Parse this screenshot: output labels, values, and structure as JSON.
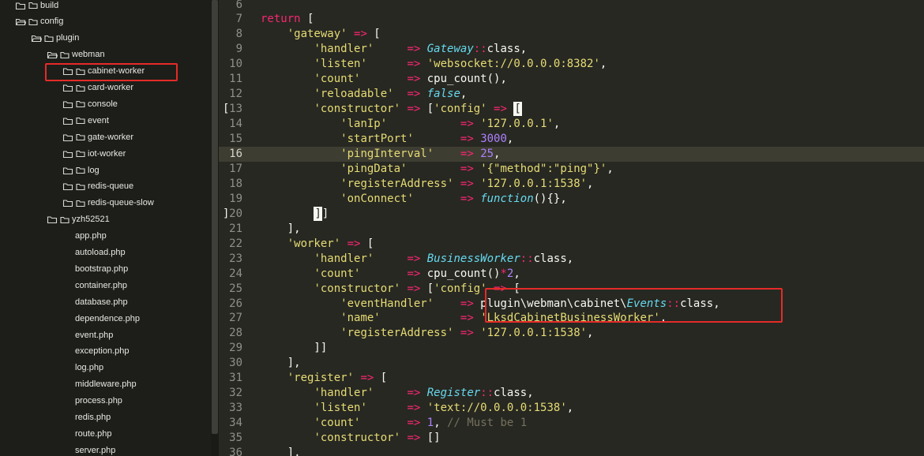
{
  "sidebar": {
    "items": [
      {
        "label": "build",
        "type": "folder",
        "open": false,
        "depth": 0
      },
      {
        "label": "config",
        "type": "folder",
        "open": true,
        "depth": 0
      },
      {
        "label": "plugin",
        "type": "folder",
        "open": true,
        "depth": 1
      },
      {
        "label": "webman",
        "type": "folder",
        "open": true,
        "depth": 2
      },
      {
        "label": "cabinet-worker",
        "type": "folder",
        "open": false,
        "depth": 3,
        "highlighted": true
      },
      {
        "label": "card-worker",
        "type": "folder",
        "open": false,
        "depth": 3
      },
      {
        "label": "console",
        "type": "folder",
        "open": false,
        "depth": 3
      },
      {
        "label": "event",
        "type": "folder",
        "open": false,
        "depth": 3
      },
      {
        "label": "gate-worker",
        "type": "folder",
        "open": false,
        "depth": 3
      },
      {
        "label": "iot-worker",
        "type": "folder",
        "open": false,
        "depth": 3
      },
      {
        "label": "log",
        "type": "folder",
        "open": false,
        "depth": 3
      },
      {
        "label": "redis-queue",
        "type": "folder",
        "open": false,
        "depth": 3
      },
      {
        "label": "redis-queue-slow",
        "type": "folder",
        "open": false,
        "depth": 3
      },
      {
        "label": "yzh52521",
        "type": "folder",
        "open": false,
        "depth": 2
      },
      {
        "label": "app.php",
        "type": "file",
        "depth": 2
      },
      {
        "label": "autoload.php",
        "type": "file",
        "depth": 2
      },
      {
        "label": "bootstrap.php",
        "type": "file",
        "depth": 2
      },
      {
        "label": "container.php",
        "type": "file",
        "depth": 2
      },
      {
        "label": "database.php",
        "type": "file",
        "depth": 2
      },
      {
        "label": "dependence.php",
        "type": "file",
        "depth": 2
      },
      {
        "label": "event.php",
        "type": "file",
        "depth": 2
      },
      {
        "label": "exception.php",
        "type": "file",
        "depth": 2
      },
      {
        "label": "log.php",
        "type": "file",
        "depth": 2
      },
      {
        "label": "middleware.php",
        "type": "file",
        "depth": 2
      },
      {
        "label": "process.php",
        "type": "file",
        "depth": 2
      },
      {
        "label": "redis.php",
        "type": "file",
        "depth": 2
      },
      {
        "label": "route.php",
        "type": "file",
        "depth": 2
      },
      {
        "label": "server.php",
        "type": "file",
        "depth": 2
      }
    ]
  },
  "editor": {
    "active_line": 16,
    "lines": [
      {
        "n": "6",
        "fold": "",
        "tokens": []
      },
      {
        "n": "7",
        "fold": "",
        "tokens": [
          [
            "kw",
            "return"
          ],
          [
            "pl",
            " ["
          ]
        ]
      },
      {
        "n": "8",
        "fold": "",
        "tokens": [
          [
            "pl",
            "    "
          ],
          [
            "str",
            "'gateway'"
          ],
          [
            "pl",
            " "
          ],
          [
            "op",
            "=>"
          ],
          [
            "pl",
            " ["
          ]
        ]
      },
      {
        "n": "9",
        "fold": "",
        "tokens": [
          [
            "pl",
            "        "
          ],
          [
            "str",
            "'handler'"
          ],
          [
            "pl",
            "     "
          ],
          [
            "op",
            "=>"
          ],
          [
            "pl",
            " "
          ],
          [
            "cls",
            "Gateway"
          ],
          [
            "op",
            "::"
          ],
          [
            "pl",
            "class,"
          ]
        ]
      },
      {
        "n": "10",
        "fold": "",
        "tokens": [
          [
            "pl",
            "        "
          ],
          [
            "str",
            "'listen'"
          ],
          [
            "pl",
            "      "
          ],
          [
            "op",
            "=>"
          ],
          [
            "pl",
            " "
          ],
          [
            "str",
            "'websocket://0.0.0.0:8382'"
          ],
          [
            "pl",
            ","
          ]
        ]
      },
      {
        "n": "11",
        "fold": "",
        "tokens": [
          [
            "pl",
            "        "
          ],
          [
            "str",
            "'count'"
          ],
          [
            "pl",
            "       "
          ],
          [
            "op",
            "=>"
          ],
          [
            "pl",
            " cpu_count(),"
          ]
        ]
      },
      {
        "n": "12",
        "fold": "",
        "tokens": [
          [
            "pl",
            "        "
          ],
          [
            "str",
            "'reloadable'"
          ],
          [
            "pl",
            "  "
          ],
          [
            "op",
            "=>"
          ],
          [
            "pl",
            " "
          ],
          [
            "cls",
            "false"
          ],
          [
            "pl",
            ","
          ]
        ]
      },
      {
        "n": "13",
        "fold": "[",
        "tokens": [
          [
            "pl",
            "        "
          ],
          [
            "str",
            "'constructor'"
          ],
          [
            "pl",
            " "
          ],
          [
            "op",
            "=>"
          ],
          [
            "pl",
            " ["
          ],
          [
            "str",
            "'config'"
          ],
          [
            "pl",
            " "
          ],
          [
            "op",
            "=>"
          ],
          [
            "pl",
            " "
          ],
          [
            "brhl",
            "["
          ]
        ]
      },
      {
        "n": "14",
        "fold": "",
        "tokens": [
          [
            "pl",
            "            "
          ],
          [
            "str",
            "'lanIp'"
          ],
          [
            "pl",
            "           "
          ],
          [
            "op",
            "=>"
          ],
          [
            "pl",
            " "
          ],
          [
            "str",
            "'127.0.0.1'"
          ],
          [
            "pl",
            ","
          ]
        ]
      },
      {
        "n": "15",
        "fold": "",
        "tokens": [
          [
            "pl",
            "            "
          ],
          [
            "str",
            "'startPort'"
          ],
          [
            "pl",
            "       "
          ],
          [
            "op",
            "=>"
          ],
          [
            "pl",
            " "
          ],
          [
            "num",
            "3000"
          ],
          [
            "pl",
            ","
          ]
        ]
      },
      {
        "n": "16",
        "fold": "",
        "tokens": [
          [
            "pl",
            "            "
          ],
          [
            "str",
            "'pingInterval'"
          ],
          [
            "pl",
            "    "
          ],
          [
            "op",
            "=>"
          ],
          [
            "pl",
            " "
          ],
          [
            "num",
            "25"
          ],
          [
            "pl",
            ","
          ]
        ]
      },
      {
        "n": "17",
        "fold": "",
        "tokens": [
          [
            "pl",
            "            "
          ],
          [
            "str",
            "'pingData'"
          ],
          [
            "pl",
            "        "
          ],
          [
            "op",
            "=>"
          ],
          [
            "pl",
            " "
          ],
          [
            "str",
            "'{\"method\":\"ping\"}'"
          ],
          [
            "pl",
            ","
          ]
        ]
      },
      {
        "n": "18",
        "fold": "",
        "tokens": [
          [
            "pl",
            "            "
          ],
          [
            "str",
            "'registerAddress'"
          ],
          [
            "pl",
            " "
          ],
          [
            "op",
            "=>"
          ],
          [
            "pl",
            " "
          ],
          [
            "str",
            "'127.0.0.1:1538'"
          ],
          [
            "pl",
            ","
          ]
        ]
      },
      {
        "n": "19",
        "fold": "",
        "tokens": [
          [
            "pl",
            "            "
          ],
          [
            "str",
            "'onConnect'"
          ],
          [
            "pl",
            "       "
          ],
          [
            "op",
            "=>"
          ],
          [
            "pl",
            " "
          ],
          [
            "cls",
            "function"
          ],
          [
            "pl",
            "(){},"
          ]
        ]
      },
      {
        "n": "20",
        "fold": "]",
        "tokens": [
          [
            "pl",
            "        "
          ],
          [
            "brhl",
            "]"
          ],
          [
            "pl",
            "]"
          ]
        ]
      },
      {
        "n": "21",
        "fold": "",
        "tokens": [
          [
            "pl",
            "    ],"
          ]
        ]
      },
      {
        "n": "22",
        "fold": "",
        "tokens": [
          [
            "pl",
            "    "
          ],
          [
            "str",
            "'worker'"
          ],
          [
            "pl",
            " "
          ],
          [
            "op",
            "=>"
          ],
          [
            "pl",
            " ["
          ]
        ]
      },
      {
        "n": "23",
        "fold": "",
        "tokens": [
          [
            "pl",
            "        "
          ],
          [
            "str",
            "'handler'"
          ],
          [
            "pl",
            "     "
          ],
          [
            "op",
            "=>"
          ],
          [
            "pl",
            " "
          ],
          [
            "cls",
            "BusinessWorker"
          ],
          [
            "op",
            "::"
          ],
          [
            "pl",
            "class,"
          ]
        ]
      },
      {
        "n": "24",
        "fold": "",
        "tokens": [
          [
            "pl",
            "        "
          ],
          [
            "str",
            "'count'"
          ],
          [
            "pl",
            "       "
          ],
          [
            "op",
            "=>"
          ],
          [
            "pl",
            " cpu_count()"
          ],
          [
            "op",
            "*"
          ],
          [
            "num",
            "2"
          ],
          [
            "pl",
            ","
          ]
        ]
      },
      {
        "n": "25",
        "fold": "",
        "tokens": [
          [
            "pl",
            "        "
          ],
          [
            "str",
            "'constructor'"
          ],
          [
            "pl",
            " "
          ],
          [
            "op",
            "=>"
          ],
          [
            "pl",
            " ["
          ],
          [
            "str",
            "'config'"
          ],
          [
            "pl",
            " "
          ],
          [
            "op",
            "=>"
          ],
          [
            "pl",
            " ["
          ]
        ]
      },
      {
        "n": "26",
        "fold": "",
        "tokens": [
          [
            "pl",
            "            "
          ],
          [
            "str",
            "'eventHandler'"
          ],
          [
            "pl",
            "    "
          ],
          [
            "op",
            "=>"
          ],
          [
            "pl",
            " plugin\\webman\\cabinet\\"
          ],
          [
            "cls",
            "Events"
          ],
          [
            "op",
            "::"
          ],
          [
            "pl",
            "class,"
          ]
        ]
      },
      {
        "n": "27",
        "fold": "",
        "tokens": [
          [
            "pl",
            "            "
          ],
          [
            "str",
            "'name'"
          ],
          [
            "pl",
            "            "
          ],
          [
            "op",
            "=>"
          ],
          [
            "pl",
            " "
          ],
          [
            "str",
            "'LksdCabinetBusinessWorker'"
          ],
          [
            "pl",
            ","
          ]
        ]
      },
      {
        "n": "28",
        "fold": "",
        "tokens": [
          [
            "pl",
            "            "
          ],
          [
            "str",
            "'registerAddress'"
          ],
          [
            "pl",
            " "
          ],
          [
            "op",
            "=>"
          ],
          [
            "pl",
            " "
          ],
          [
            "str",
            "'127.0.0.1:1538'"
          ],
          [
            "pl",
            ","
          ]
        ]
      },
      {
        "n": "29",
        "fold": "",
        "tokens": [
          [
            "pl",
            "        ]]"
          ]
        ]
      },
      {
        "n": "30",
        "fold": "",
        "tokens": [
          [
            "pl",
            "    ],"
          ]
        ]
      },
      {
        "n": "31",
        "fold": "",
        "tokens": [
          [
            "pl",
            "    "
          ],
          [
            "str",
            "'register'"
          ],
          [
            "pl",
            " "
          ],
          [
            "op",
            "=>"
          ],
          [
            "pl",
            " ["
          ]
        ]
      },
      {
        "n": "32",
        "fold": "",
        "tokens": [
          [
            "pl",
            "        "
          ],
          [
            "str",
            "'handler'"
          ],
          [
            "pl",
            "     "
          ],
          [
            "op",
            "=>"
          ],
          [
            "pl",
            " "
          ],
          [
            "cls",
            "Register"
          ],
          [
            "op",
            "::"
          ],
          [
            "pl",
            "class,"
          ]
        ]
      },
      {
        "n": "33",
        "fold": "",
        "tokens": [
          [
            "pl",
            "        "
          ],
          [
            "str",
            "'listen'"
          ],
          [
            "pl",
            "      "
          ],
          [
            "op",
            "=>"
          ],
          [
            "pl",
            " "
          ],
          [
            "str",
            "'text://0.0.0.0:1538'"
          ],
          [
            "pl",
            ","
          ]
        ]
      },
      {
        "n": "34",
        "fold": "",
        "tokens": [
          [
            "pl",
            "        "
          ],
          [
            "str",
            "'count'"
          ],
          [
            "pl",
            "       "
          ],
          [
            "op",
            "=>"
          ],
          [
            "pl",
            " "
          ],
          [
            "num",
            "1"
          ],
          [
            "pl",
            ", "
          ],
          [
            "cm",
            "// Must be 1"
          ]
        ]
      },
      {
        "n": "35",
        "fold": "",
        "tokens": [
          [
            "pl",
            "        "
          ],
          [
            "str",
            "'constructor'"
          ],
          [
            "pl",
            " "
          ],
          [
            "op",
            "=>"
          ],
          [
            "pl",
            " []"
          ]
        ]
      },
      {
        "n": "36",
        "fold": "",
        "tokens": [
          [
            "pl",
            "    ],"
          ]
        ]
      }
    ]
  },
  "colors": {
    "editor_bg": "#272822",
    "sidebar_bg": "#1d1e1a",
    "highlight_box": "#e52b28",
    "string": "#e6db74",
    "keyword": "#f92672",
    "class": "#66d9ef",
    "number": "#ae81ff",
    "comment": "#75715e"
  }
}
